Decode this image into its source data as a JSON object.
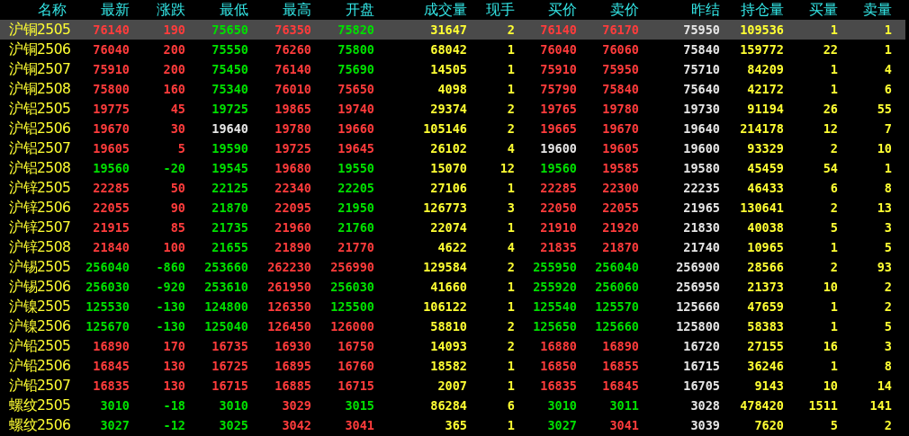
{
  "columns": [
    {
      "label": "名称",
      "kind": "name"
    },
    {
      "label": "最新",
      "kind": "price"
    },
    {
      "label": "涨跌",
      "kind": "price"
    },
    {
      "label": "最低",
      "kind": "price"
    },
    {
      "label": "最高",
      "kind": "price"
    },
    {
      "label": "开盘",
      "kind": "price"
    },
    {
      "label": "成交量",
      "kind": "volume"
    },
    {
      "label": "现手",
      "kind": "volume"
    },
    {
      "label": "买价",
      "kind": "price"
    },
    {
      "label": "卖价",
      "kind": "price"
    },
    {
      "label": "昨结",
      "kind": "price"
    },
    {
      "label": "持仓量",
      "kind": "volume"
    },
    {
      "label": "买量",
      "kind": "volume"
    },
    {
      "label": "卖量",
      "kind": "volume"
    }
  ],
  "rows": [
    {
      "name": "沪铜2505",
      "selected": true,
      "cells": [
        {
          "text": "76140",
          "color": "#ff3c3c"
        },
        {
          "text": "190",
          "color": "#ff3c3c"
        },
        {
          "text": "75650",
          "color": "#00e000"
        },
        {
          "text": "76350",
          "color": "#ff3c3c"
        },
        {
          "text": "75820",
          "color": "#00e000"
        },
        {
          "text": "31647"
        },
        {
          "text": "2"
        },
        {
          "text": "76140",
          "color": "#ff3c3c"
        },
        {
          "text": "76170",
          "color": "#ff3c3c"
        },
        {
          "text": "75950",
          "color": "#e6e6e6"
        },
        {
          "text": "109536"
        },
        {
          "text": "1"
        },
        {
          "text": "1"
        }
      ]
    },
    {
      "name": "沪铜2506",
      "selected": false,
      "cells": [
        {
          "text": "76040",
          "color": "#ff3c3c"
        },
        {
          "text": "200",
          "color": "#ff3c3c"
        },
        {
          "text": "75550",
          "color": "#00e000"
        },
        {
          "text": "76260",
          "color": "#ff3c3c"
        },
        {
          "text": "75800",
          "color": "#00e000"
        },
        {
          "text": "68042"
        },
        {
          "text": "1"
        },
        {
          "text": "76040",
          "color": "#ff3c3c"
        },
        {
          "text": "76060",
          "color": "#ff3c3c"
        },
        {
          "text": "75840",
          "color": "#e6e6e6"
        },
        {
          "text": "159772"
        },
        {
          "text": "22"
        },
        {
          "text": "1"
        }
      ]
    },
    {
      "name": "沪铜2507",
      "selected": false,
      "cells": [
        {
          "text": "75910",
          "color": "#ff3c3c"
        },
        {
          "text": "200",
          "color": "#ff3c3c"
        },
        {
          "text": "75450",
          "color": "#00e000"
        },
        {
          "text": "76140",
          "color": "#ff3c3c"
        },
        {
          "text": "75690",
          "color": "#00e000"
        },
        {
          "text": "14505"
        },
        {
          "text": "1"
        },
        {
          "text": "75910",
          "color": "#ff3c3c"
        },
        {
          "text": "75950",
          "color": "#ff3c3c"
        },
        {
          "text": "75710",
          "color": "#e6e6e6"
        },
        {
          "text": "84209"
        },
        {
          "text": "1"
        },
        {
          "text": "4"
        }
      ]
    },
    {
      "name": "沪铜2508",
      "selected": false,
      "cells": [
        {
          "text": "75800",
          "color": "#ff3c3c"
        },
        {
          "text": "160",
          "color": "#ff3c3c"
        },
        {
          "text": "75340",
          "color": "#00e000"
        },
        {
          "text": "76010",
          "color": "#ff3c3c"
        },
        {
          "text": "75650",
          "color": "#ff3c3c"
        },
        {
          "text": "4098"
        },
        {
          "text": "1"
        },
        {
          "text": "75790",
          "color": "#ff3c3c"
        },
        {
          "text": "75840",
          "color": "#ff3c3c"
        },
        {
          "text": "75640",
          "color": "#e6e6e6"
        },
        {
          "text": "42172"
        },
        {
          "text": "1"
        },
        {
          "text": "6"
        }
      ]
    },
    {
      "name": "沪铝2505",
      "selected": false,
      "cells": [
        {
          "text": "19775",
          "color": "#ff3c3c"
        },
        {
          "text": "45",
          "color": "#ff3c3c"
        },
        {
          "text": "19725",
          "color": "#00e000"
        },
        {
          "text": "19865",
          "color": "#ff3c3c"
        },
        {
          "text": "19740",
          "color": "#ff3c3c"
        },
        {
          "text": "29374"
        },
        {
          "text": "2"
        },
        {
          "text": "19765",
          "color": "#ff3c3c"
        },
        {
          "text": "19780",
          "color": "#ff3c3c"
        },
        {
          "text": "19730",
          "color": "#e6e6e6"
        },
        {
          "text": "91194"
        },
        {
          "text": "26"
        },
        {
          "text": "55"
        }
      ]
    },
    {
      "name": "沪铝2506",
      "selected": false,
      "cells": [
        {
          "text": "19670",
          "color": "#ff3c3c"
        },
        {
          "text": "30",
          "color": "#ff3c3c"
        },
        {
          "text": "19640",
          "color": "#e6e6e6"
        },
        {
          "text": "19780",
          "color": "#ff3c3c"
        },
        {
          "text": "19660",
          "color": "#ff3c3c"
        },
        {
          "text": "105146"
        },
        {
          "text": "2"
        },
        {
          "text": "19665",
          "color": "#ff3c3c"
        },
        {
          "text": "19670",
          "color": "#ff3c3c"
        },
        {
          "text": "19640",
          "color": "#e6e6e6"
        },
        {
          "text": "214178"
        },
        {
          "text": "12"
        },
        {
          "text": "7"
        }
      ]
    },
    {
      "name": "沪铝2507",
      "selected": false,
      "cells": [
        {
          "text": "19605",
          "color": "#ff3c3c"
        },
        {
          "text": "5",
          "color": "#ff3c3c"
        },
        {
          "text": "19590",
          "color": "#00e000"
        },
        {
          "text": "19725",
          "color": "#ff3c3c"
        },
        {
          "text": "19645",
          "color": "#ff3c3c"
        },
        {
          "text": "26102"
        },
        {
          "text": "4"
        },
        {
          "text": "19600",
          "color": "#e6e6e6"
        },
        {
          "text": "19605",
          "color": "#ff3c3c"
        },
        {
          "text": "19600",
          "color": "#e6e6e6"
        },
        {
          "text": "93329"
        },
        {
          "text": "2"
        },
        {
          "text": "10"
        }
      ]
    },
    {
      "name": "沪铝2508",
      "selected": false,
      "cells": [
        {
          "text": "19560",
          "color": "#00e000"
        },
        {
          "text": "-20",
          "color": "#00e000"
        },
        {
          "text": "19545",
          "color": "#00e000"
        },
        {
          "text": "19680",
          "color": "#ff3c3c"
        },
        {
          "text": "19550",
          "color": "#00e000"
        },
        {
          "text": "15070"
        },
        {
          "text": "12"
        },
        {
          "text": "19560",
          "color": "#00e000"
        },
        {
          "text": "19585",
          "color": "#ff3c3c"
        },
        {
          "text": "19580",
          "color": "#e6e6e6"
        },
        {
          "text": "45459"
        },
        {
          "text": "54"
        },
        {
          "text": "1"
        }
      ]
    },
    {
      "name": "沪锌2505",
      "selected": false,
      "cells": [
        {
          "text": "22285",
          "color": "#ff3c3c"
        },
        {
          "text": "50",
          "color": "#ff3c3c"
        },
        {
          "text": "22125",
          "color": "#00e000"
        },
        {
          "text": "22340",
          "color": "#ff3c3c"
        },
        {
          "text": "22205",
          "color": "#00e000"
        },
        {
          "text": "27106"
        },
        {
          "text": "1"
        },
        {
          "text": "22285",
          "color": "#ff3c3c"
        },
        {
          "text": "22300",
          "color": "#ff3c3c"
        },
        {
          "text": "22235",
          "color": "#e6e6e6"
        },
        {
          "text": "46433"
        },
        {
          "text": "6"
        },
        {
          "text": "8"
        }
      ]
    },
    {
      "name": "沪锌2506",
      "selected": false,
      "cells": [
        {
          "text": "22055",
          "color": "#ff3c3c"
        },
        {
          "text": "90",
          "color": "#ff3c3c"
        },
        {
          "text": "21870",
          "color": "#00e000"
        },
        {
          "text": "22095",
          "color": "#ff3c3c"
        },
        {
          "text": "21950",
          "color": "#00e000"
        },
        {
          "text": "126773"
        },
        {
          "text": "3"
        },
        {
          "text": "22050",
          "color": "#ff3c3c"
        },
        {
          "text": "22055",
          "color": "#ff3c3c"
        },
        {
          "text": "21965",
          "color": "#e6e6e6"
        },
        {
          "text": "130641"
        },
        {
          "text": "2"
        },
        {
          "text": "13"
        }
      ]
    },
    {
      "name": "沪锌2507",
      "selected": false,
      "cells": [
        {
          "text": "21915",
          "color": "#ff3c3c"
        },
        {
          "text": "85",
          "color": "#ff3c3c"
        },
        {
          "text": "21735",
          "color": "#00e000"
        },
        {
          "text": "21960",
          "color": "#ff3c3c"
        },
        {
          "text": "21760",
          "color": "#00e000"
        },
        {
          "text": "22074"
        },
        {
          "text": "1"
        },
        {
          "text": "21910",
          "color": "#ff3c3c"
        },
        {
          "text": "21920",
          "color": "#ff3c3c"
        },
        {
          "text": "21830",
          "color": "#e6e6e6"
        },
        {
          "text": "40038"
        },
        {
          "text": "5"
        },
        {
          "text": "3"
        }
      ]
    },
    {
      "name": "沪锌2508",
      "selected": false,
      "cells": [
        {
          "text": "21840",
          "color": "#ff3c3c"
        },
        {
          "text": "100",
          "color": "#ff3c3c"
        },
        {
          "text": "21655",
          "color": "#00e000"
        },
        {
          "text": "21890",
          "color": "#ff3c3c"
        },
        {
          "text": "21770",
          "color": "#ff3c3c"
        },
        {
          "text": "4622"
        },
        {
          "text": "4"
        },
        {
          "text": "21835",
          "color": "#ff3c3c"
        },
        {
          "text": "21870",
          "color": "#ff3c3c"
        },
        {
          "text": "21740",
          "color": "#e6e6e6"
        },
        {
          "text": "10965"
        },
        {
          "text": "1"
        },
        {
          "text": "5"
        }
      ]
    },
    {
      "name": "沪锡2505",
      "selected": false,
      "cells": [
        {
          "text": "256040",
          "color": "#00e000"
        },
        {
          "text": "-860",
          "color": "#00e000"
        },
        {
          "text": "253660",
          "color": "#00e000"
        },
        {
          "text": "262230",
          "color": "#ff3c3c"
        },
        {
          "text": "256990",
          "color": "#ff3c3c"
        },
        {
          "text": "129584"
        },
        {
          "text": "2"
        },
        {
          "text": "255950",
          "color": "#00e000"
        },
        {
          "text": "256040",
          "color": "#00e000"
        },
        {
          "text": "256900",
          "color": "#e6e6e6"
        },
        {
          "text": "28566"
        },
        {
          "text": "2"
        },
        {
          "text": "93"
        }
      ]
    },
    {
      "name": "沪锡2506",
      "selected": false,
      "cells": [
        {
          "text": "256030",
          "color": "#00e000"
        },
        {
          "text": "-920",
          "color": "#00e000"
        },
        {
          "text": "253610",
          "color": "#00e000"
        },
        {
          "text": "261950",
          "color": "#ff3c3c"
        },
        {
          "text": "256030",
          "color": "#00e000"
        },
        {
          "text": "41660"
        },
        {
          "text": "1"
        },
        {
          "text": "255920",
          "color": "#00e000"
        },
        {
          "text": "256060",
          "color": "#00e000"
        },
        {
          "text": "256950",
          "color": "#e6e6e6"
        },
        {
          "text": "21373"
        },
        {
          "text": "10"
        },
        {
          "text": "2"
        }
      ]
    },
    {
      "name": "沪镍2505",
      "selected": false,
      "cells": [
        {
          "text": "125530",
          "color": "#00e000"
        },
        {
          "text": "-130",
          "color": "#00e000"
        },
        {
          "text": "124800",
          "color": "#00e000"
        },
        {
          "text": "126350",
          "color": "#ff3c3c"
        },
        {
          "text": "125500",
          "color": "#00e000"
        },
        {
          "text": "106122"
        },
        {
          "text": "1"
        },
        {
          "text": "125540",
          "color": "#00e000"
        },
        {
          "text": "125570",
          "color": "#00e000"
        },
        {
          "text": "125660",
          "color": "#e6e6e6"
        },
        {
          "text": "47659"
        },
        {
          "text": "1"
        },
        {
          "text": "2"
        }
      ]
    },
    {
      "name": "沪镍2506",
      "selected": false,
      "cells": [
        {
          "text": "125670",
          "color": "#00e000"
        },
        {
          "text": "-130",
          "color": "#00e000"
        },
        {
          "text": "125040",
          "color": "#00e000"
        },
        {
          "text": "126450",
          "color": "#ff3c3c"
        },
        {
          "text": "126000",
          "color": "#ff3c3c"
        },
        {
          "text": "58810"
        },
        {
          "text": "2"
        },
        {
          "text": "125650",
          "color": "#00e000"
        },
        {
          "text": "125660",
          "color": "#00e000"
        },
        {
          "text": "125800",
          "color": "#e6e6e6"
        },
        {
          "text": "58383"
        },
        {
          "text": "1"
        },
        {
          "text": "5"
        }
      ]
    },
    {
      "name": "沪铅2505",
      "selected": false,
      "cells": [
        {
          "text": "16890",
          "color": "#ff3c3c"
        },
        {
          "text": "170",
          "color": "#ff3c3c"
        },
        {
          "text": "16735",
          "color": "#ff3c3c"
        },
        {
          "text": "16930",
          "color": "#ff3c3c"
        },
        {
          "text": "16750",
          "color": "#ff3c3c"
        },
        {
          "text": "14093"
        },
        {
          "text": "2"
        },
        {
          "text": "16880",
          "color": "#ff3c3c"
        },
        {
          "text": "16890",
          "color": "#ff3c3c"
        },
        {
          "text": "16720",
          "color": "#e6e6e6"
        },
        {
          "text": "27155"
        },
        {
          "text": "16"
        },
        {
          "text": "3"
        }
      ]
    },
    {
      "name": "沪铅2506",
      "selected": false,
      "cells": [
        {
          "text": "16845",
          "color": "#ff3c3c"
        },
        {
          "text": "130",
          "color": "#ff3c3c"
        },
        {
          "text": "16725",
          "color": "#ff3c3c"
        },
        {
          "text": "16895",
          "color": "#ff3c3c"
        },
        {
          "text": "16760",
          "color": "#ff3c3c"
        },
        {
          "text": "18582"
        },
        {
          "text": "1"
        },
        {
          "text": "16850",
          "color": "#ff3c3c"
        },
        {
          "text": "16855",
          "color": "#ff3c3c"
        },
        {
          "text": "16715",
          "color": "#e6e6e6"
        },
        {
          "text": "36246"
        },
        {
          "text": "1"
        },
        {
          "text": "8"
        }
      ]
    },
    {
      "name": "沪铅2507",
      "selected": false,
      "cells": [
        {
          "text": "16835",
          "color": "#ff3c3c"
        },
        {
          "text": "130",
          "color": "#ff3c3c"
        },
        {
          "text": "16715",
          "color": "#ff3c3c"
        },
        {
          "text": "16885",
          "color": "#ff3c3c"
        },
        {
          "text": "16715",
          "color": "#ff3c3c"
        },
        {
          "text": "2007"
        },
        {
          "text": "1"
        },
        {
          "text": "16835",
          "color": "#ff3c3c"
        },
        {
          "text": "16845",
          "color": "#ff3c3c"
        },
        {
          "text": "16705",
          "color": "#e6e6e6"
        },
        {
          "text": "9143"
        },
        {
          "text": "10"
        },
        {
          "text": "14"
        }
      ]
    },
    {
      "name": "螺纹2505",
      "selected": false,
      "cells": [
        {
          "text": "3010",
          "color": "#00e000"
        },
        {
          "text": "-18",
          "color": "#00e000"
        },
        {
          "text": "3010",
          "color": "#00e000"
        },
        {
          "text": "3029",
          "color": "#ff3c3c"
        },
        {
          "text": "3015",
          "color": "#00e000"
        },
        {
          "text": "86284"
        },
        {
          "text": "6"
        },
        {
          "text": "3010",
          "color": "#00e000"
        },
        {
          "text": "3011",
          "color": "#00e000"
        },
        {
          "text": "3028",
          "color": "#e6e6e6"
        },
        {
          "text": "478420"
        },
        {
          "text": "1511"
        },
        {
          "text": "141"
        }
      ]
    },
    {
      "name": "螺纹2506",
      "selected": false,
      "cells": [
        {
          "text": "3027",
          "color": "#00e000"
        },
        {
          "text": "-12",
          "color": "#00e000"
        },
        {
          "text": "3025",
          "color": "#00e000"
        },
        {
          "text": "3042",
          "color": "#ff3c3c"
        },
        {
          "text": "3041",
          "color": "#ff3c3c"
        },
        {
          "text": "365"
        },
        {
          "text": "1"
        },
        {
          "text": "3027",
          "color": "#00e000"
        },
        {
          "text": "3041",
          "color": "#ff3c3c"
        },
        {
          "text": "3039",
          "color": "#e6e6e6"
        },
        {
          "text": "7620"
        },
        {
          "text": "5"
        },
        {
          "text": "2"
        }
      ]
    }
  ]
}
